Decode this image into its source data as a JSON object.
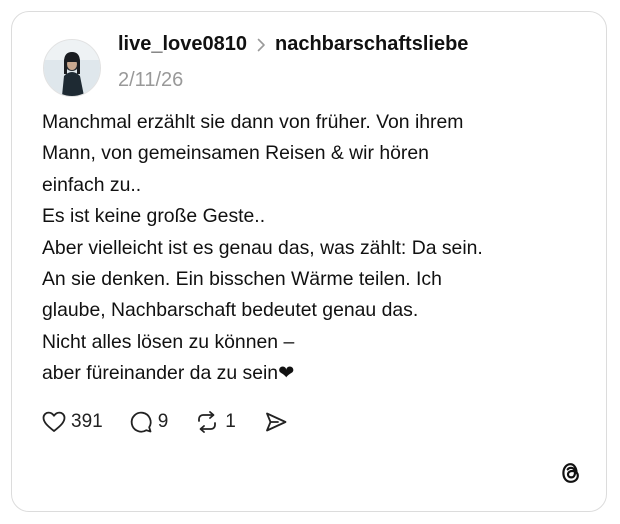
{
  "post": {
    "username": "live_love0810",
    "community": "nachbarschaftsliebe",
    "date": "2/11/26",
    "lines": [
      "Manchmal erzählt sie dann von früher. Von ihrem",
      "Mann, von gemeinsamen Reisen & wir hören",
      "einfach zu..",
      "Es ist keine große Geste..",
      "Aber vielleicht ist es genau das, was zählt: Da sein.",
      "An sie denken. Ein bisschen Wärme teilen. Ich",
      "glaube, Nachbarschaft bedeutet genau das.",
      "Nicht alles lösen zu können –",
      "aber füreinander da zu sein❤"
    ]
  },
  "actions": {
    "likes": "391",
    "comments": "9",
    "reposts": "1",
    "like_icon": "heart-icon",
    "comment_icon": "comment-bubble-icon",
    "repost_icon": "repost-icon",
    "share_icon": "send-icon"
  },
  "branding": {
    "logo": "threads-logo-icon"
  },
  "colors": {
    "text": "#111111",
    "muted": "#999999",
    "border": "#dcdcdc",
    "background": "#ffffff"
  }
}
